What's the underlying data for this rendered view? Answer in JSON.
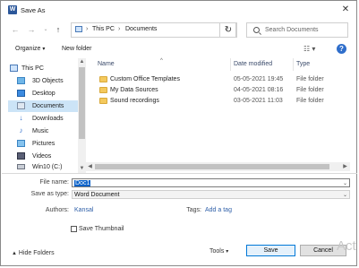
{
  "window": {
    "title": "Save As",
    "app_icon_letter": "W"
  },
  "navigation": {
    "back_icon": "arrow-left",
    "forward_icon": "arrow-right",
    "recent_icon": "chevron-down",
    "up_icon": "arrow-up",
    "breadcrumb": [
      "This PC",
      "Documents"
    ],
    "search_placeholder": "Search Documents"
  },
  "toolbar": {
    "organize_label": "Organize",
    "new_folder_label": "New folder",
    "help_label": "?"
  },
  "nav_pane": {
    "items": [
      {
        "label": "This PC",
        "icon": "pc-icon"
      },
      {
        "label": "3D Objects",
        "icon": "cube-icon"
      },
      {
        "label": "Desktop",
        "icon": "desktop-icon"
      },
      {
        "label": "Documents",
        "icon": "documents-icon",
        "selected": true
      },
      {
        "label": "Downloads",
        "icon": "download-icon"
      },
      {
        "label": "Music",
        "icon": "music-icon"
      },
      {
        "label": "Pictures",
        "icon": "pictures-icon"
      },
      {
        "label": "Videos",
        "icon": "videos-icon"
      },
      {
        "label": "Win10 (C:)",
        "icon": "drive-icon"
      }
    ]
  },
  "file_list": {
    "columns": [
      "Name",
      "Date modified",
      "Type"
    ],
    "rows": [
      {
        "name": "Custom Office Templates",
        "date": "05-05-2021 19:45",
        "type": "File folder"
      },
      {
        "name": "My Data Sources",
        "date": "04-05-2021 08:16",
        "type": "File folder"
      },
      {
        "name": "Sound recordings",
        "date": "03-05-2021 11:03",
        "type": "File folder"
      }
    ]
  },
  "form": {
    "file_name_label": "File name:",
    "file_name_value": "Doc1",
    "save_as_type_label": "Save as type:",
    "save_as_type_value": "Word Document",
    "authors_label": "Authors:",
    "authors_value": "Kansal",
    "tags_label": "Tags:",
    "tags_value": "Add a tag",
    "thumbnail_label": "Save Thumbnail"
  },
  "footer": {
    "hide_folders_label": "Hide Folders",
    "tools_label": "Tools",
    "save_label": "Save",
    "cancel_label": "Cancel"
  },
  "watermark": "Act"
}
